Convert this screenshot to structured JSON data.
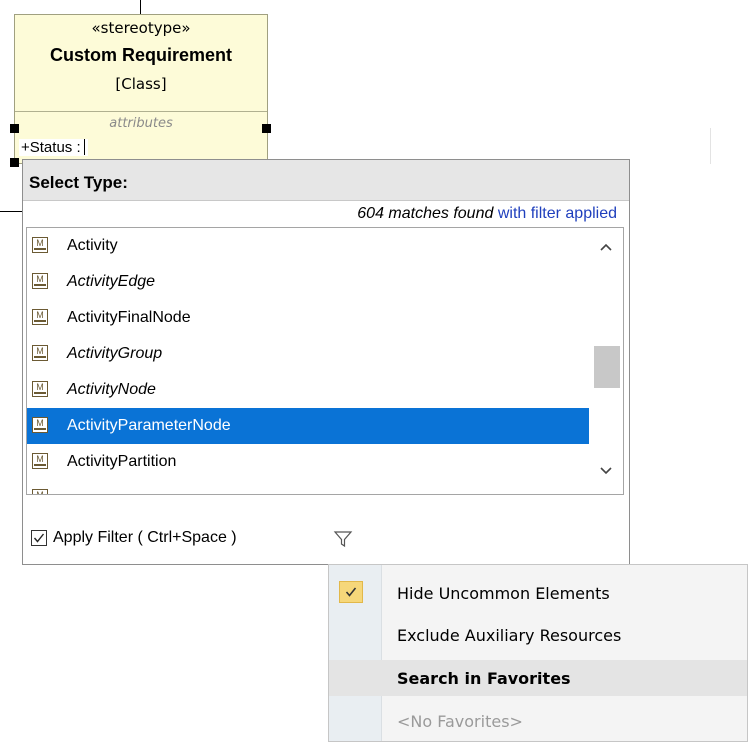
{
  "diagram": {
    "stereotype": "«stereotype»",
    "class_name": "Custom Requirement",
    "class_kind": "[Class]",
    "compartment_label": "attributes",
    "attribute_edit": "+Status :"
  },
  "select_type": {
    "title": "Select Type:",
    "matches_count": "604 matches found",
    "matches_suffix": "with filter applied",
    "items": [
      {
        "label": "Activity",
        "italic": false,
        "selected": false,
        "icon": "metaclass-icon"
      },
      {
        "label": "ActivityEdge",
        "italic": true,
        "selected": false,
        "icon": "metaclass-icon"
      },
      {
        "label": "ActivityFinalNode",
        "italic": false,
        "selected": false,
        "icon": "metaclass-icon"
      },
      {
        "label": "ActivityGroup",
        "italic": true,
        "selected": false,
        "icon": "metaclass-icon"
      },
      {
        "label": "ActivityNode",
        "italic": true,
        "selected": false,
        "icon": "metaclass-icon"
      },
      {
        "label": "ActivityParameterNode",
        "italic": false,
        "selected": true,
        "icon": "metaclass-icon"
      },
      {
        "label": "ActivityPartition",
        "italic": false,
        "selected": false,
        "icon": "metaclass-icon"
      }
    ],
    "apply_filter_label": "Apply Filter ( Ctrl+Space )",
    "apply_filter_checked": true
  },
  "filter_menu": {
    "items": [
      {
        "label": "Hide Uncommon Elements",
        "checked": true,
        "state": "normal"
      },
      {
        "label": "Exclude Auxiliary Resources",
        "checked": false,
        "state": "normal"
      },
      {
        "label": "Search in Favorites",
        "checked": false,
        "state": "hover"
      },
      {
        "label": "<No Favorites>",
        "checked": false,
        "state": "disabled"
      }
    ]
  },
  "colors": {
    "selection": "#0a73d6",
    "class_fill": "#fdfbd8",
    "link_blue": "#1f3fbd",
    "check_highlight": "#f6d77a"
  }
}
